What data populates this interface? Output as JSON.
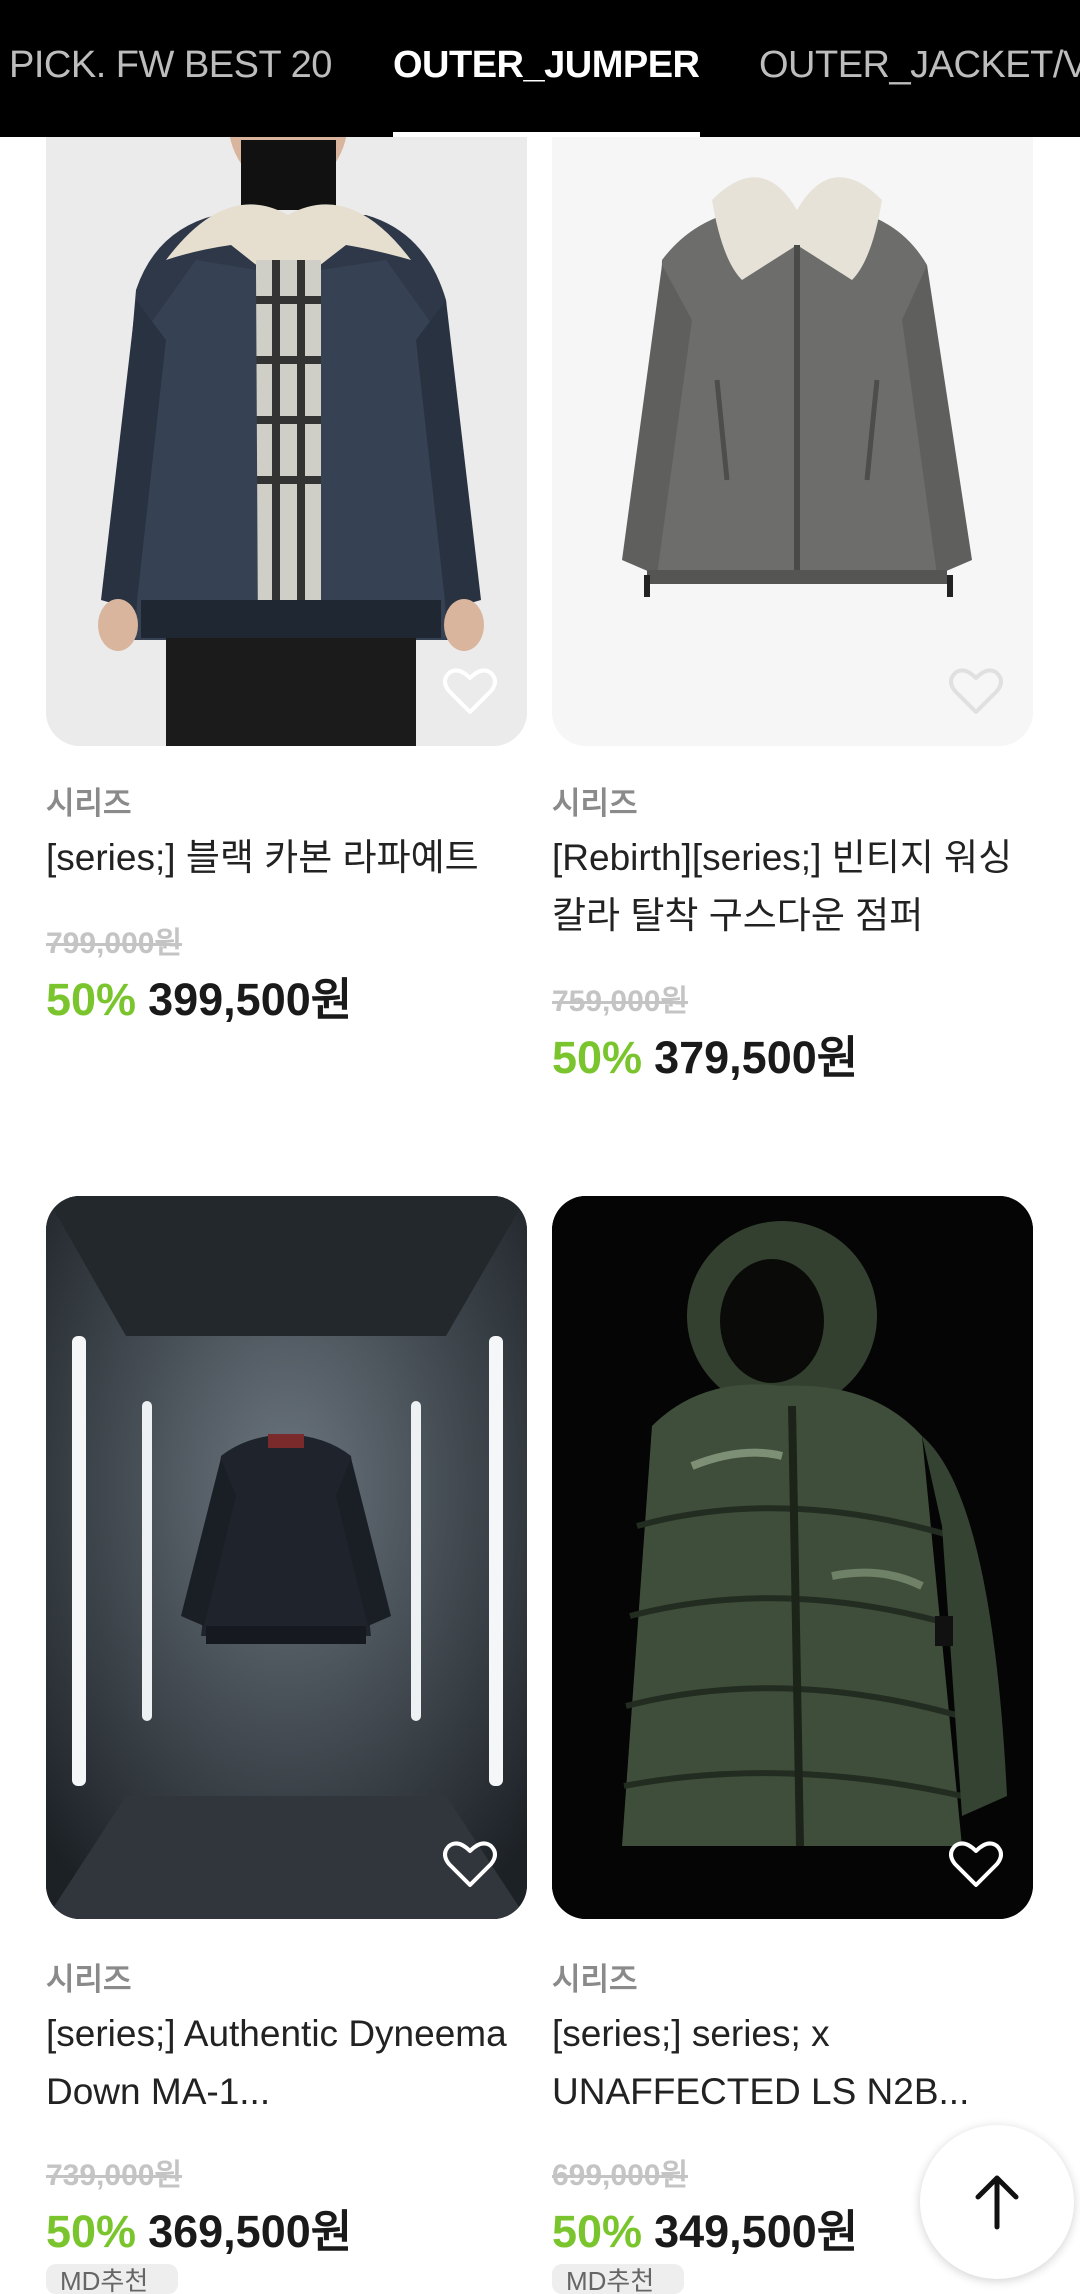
{
  "tabs": [
    {
      "label": "PICK. FW BEST 20",
      "active": false
    },
    {
      "label": "OUTER_JUMPER",
      "active": true
    },
    {
      "label": "OUTER_JACKET/VEST",
      "active": false
    }
  ],
  "products": [
    {
      "brand": "시리즈",
      "title": "[series;] 블랙 카본 라파예트",
      "original_price": "799,000원",
      "discount": "50%",
      "price": "399,500원",
      "image": "man-black-leather-jacket-shearling-collar",
      "wishlist_icon": "heart-outline-icon"
    },
    {
      "brand": "시리즈",
      "title": "[Rebirth][series;] 빈티지 워싱 칼라 탈착 구스다운 점퍼",
      "original_price": "759,000원",
      "discount": "50%",
      "price": "379,500원",
      "image": "grey-jacket-shearling-collar",
      "wishlist_icon": "heart-outline-icon"
    },
    {
      "brand": "시리즈",
      "title": "[series;] Authentic Dyneema Down MA-1...",
      "original_price": "739,000원",
      "discount": "50%",
      "price": "369,500원",
      "badge": "MD추천",
      "image": "dark-bomber-jacket-neon-room",
      "wishlist_icon": "heart-outline-icon"
    },
    {
      "brand": "시리즈",
      "title": "[series;] series; x UNAFFECTED LS N2B...",
      "original_price": "699,000원",
      "discount": "50%",
      "price": "349,500원",
      "badge": "MD추천",
      "image": "green-puffer-parka",
      "wishlist_icon": "heart-outline-icon"
    }
  ],
  "scroll_top_icon": "arrow-up-icon",
  "colors": {
    "tabbar_bg": "#000000",
    "discount_green": "#7ac52d",
    "strike_grey": "#c4c4c4",
    "brand_grey": "#8a8a8a"
  }
}
